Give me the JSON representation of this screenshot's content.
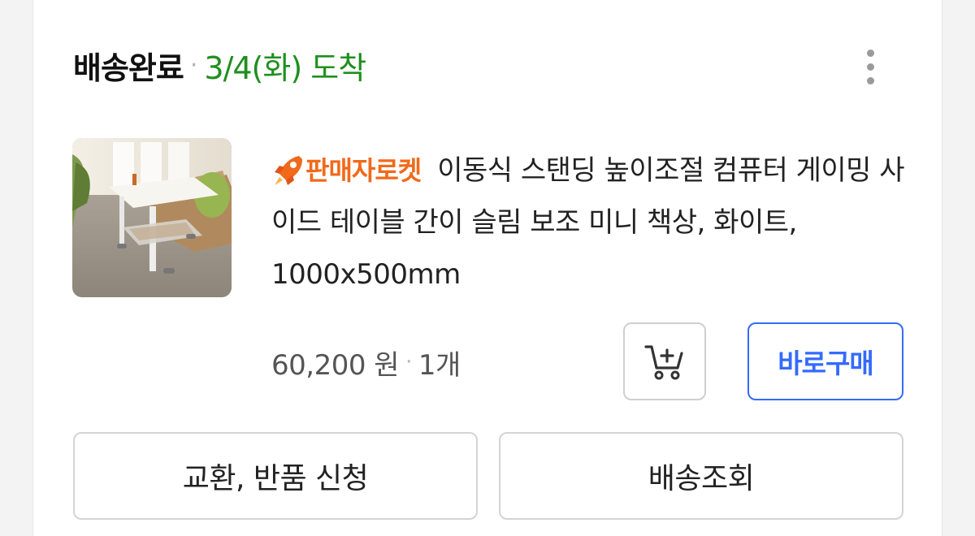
{
  "order": {
    "status": "배송완료",
    "separator": "·",
    "arrival": "3/4(화) 도착",
    "more_icon": "more-vertical-icon"
  },
  "product": {
    "badge_icon": "rocket-icon",
    "badge_label": "판매자로켓",
    "title": "이동식 스탠딩 높이조절 컴퓨터 게이밍 사이드 테이블 간이 슬림 보조 미니 책상, 화이트, 1000x500mm",
    "price": "60,200 원",
    "separator": "·",
    "quantity": "1개"
  },
  "actions": {
    "cart_icon": "add-to-cart-icon",
    "buy_now_label": "바로구매",
    "exchange_return_label": "교환, 반품 신청",
    "tracking_label": "배송조회"
  },
  "colors": {
    "arrival_green": "#1f8f1f",
    "badge_orange": "#f06a1a",
    "buy_blue": "#346aff"
  }
}
